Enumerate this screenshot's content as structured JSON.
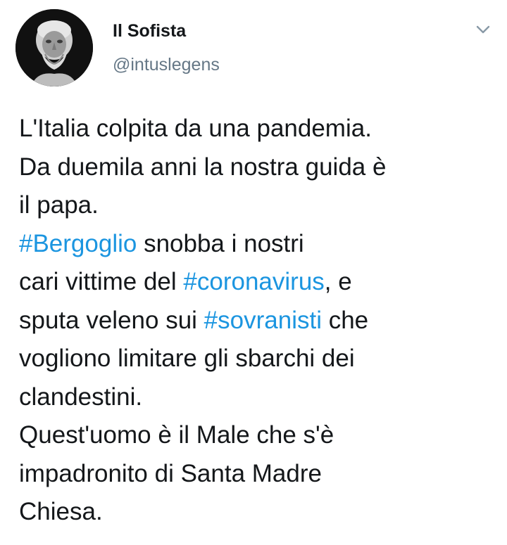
{
  "author": {
    "display_name": "Il Sofista",
    "handle": "@intuslegens",
    "avatar_icon": "philosopher-bust-avatar"
  },
  "menu_icon": "chevron-down-icon",
  "colors": {
    "text": "#14171a",
    "secondary": "#657786",
    "hashtag": "#1b95e0",
    "background": "#ffffff"
  },
  "tweet": {
    "line1": "L'Italia colpita da una pandemia.",
    "line2": "Da duemila anni la nostra guida è",
    "line3": "il papa.",
    "hashtag_bergoglio": "#Bergoglio",
    "line4_rest": " snobba i nostri",
    "line5_pre": "cari vittime del ",
    "hashtag_coronavirus": "#coronavirus",
    "line5_post": ", e",
    "line6_pre": "sputa veleno sui ",
    "hashtag_sovranisti": "#sovranisti",
    "line6_post": " che",
    "line7": "vogliono limitare gli sbarchi dei",
    "line8": "clandestini.",
    "line9": "Quest'uomo è il Male che s'è",
    "line10": "impadronito di Santa Madre",
    "line11": "Chiesa."
  }
}
